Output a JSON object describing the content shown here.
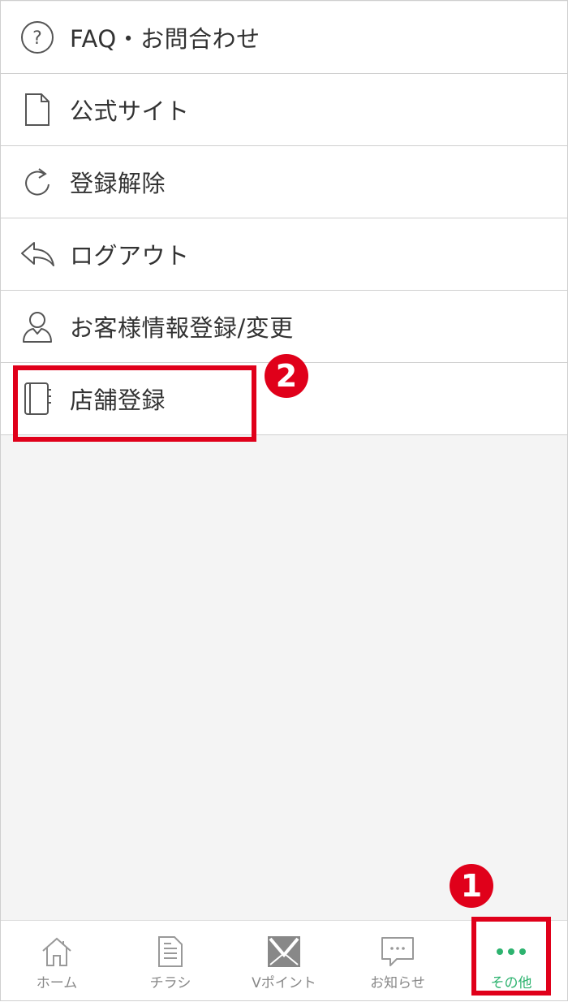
{
  "menu": {
    "items": [
      {
        "label": "FAQ・お問合わせ",
        "icon": "question-circle-icon"
      },
      {
        "label": "公式サイト",
        "icon": "document-icon"
      },
      {
        "label": "登録解除",
        "icon": "refresh-icon"
      },
      {
        "label": "ログアウト",
        "icon": "reply-arrow-icon"
      },
      {
        "label": "お客様情報登録/変更",
        "icon": "user-icon"
      },
      {
        "label": "店舗登録",
        "icon": "notebook-icon"
      }
    ]
  },
  "annotations": {
    "badge_1": "1",
    "badge_2": "2",
    "color": "#e0001a"
  },
  "tabbar": {
    "tabs": [
      {
        "label": "ホーム",
        "icon": "home-icon"
      },
      {
        "label": "チラシ",
        "icon": "flyer-icon"
      },
      {
        "label": "Vポイント",
        "icon": "v-point-icon"
      },
      {
        "label": "お知らせ",
        "icon": "chat-bubble-icon"
      },
      {
        "label": "その他",
        "icon": "more-dots-icon",
        "active": true
      }
    ],
    "active_color": "#2db36f"
  }
}
